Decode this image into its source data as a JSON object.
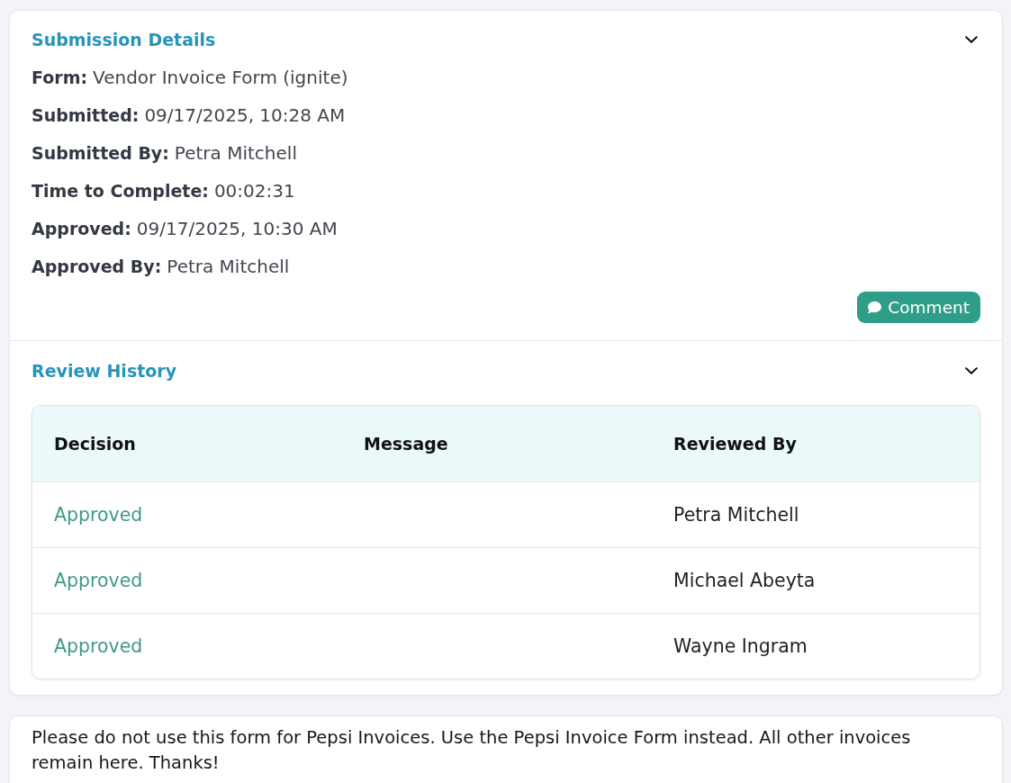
{
  "sections": [
    {
      "kind": "details",
      "title": "Submission Details",
      "expanded": true,
      "fields": [
        {
          "label": "Form:",
          "value": "Vendor Invoice Form (ignite)"
        },
        {
          "label": "Submitted:",
          "value": "09/17/2025, 10:28 AM"
        },
        {
          "label": "Submitted By:",
          "value": "Petra Mitchell"
        },
        {
          "label": "Time to Complete:",
          "value": "00:02:31"
        },
        {
          "label": "Approved:",
          "value": "09/17/2025, 10:30 AM"
        },
        {
          "label": "Approved By:",
          "value": "Petra Mitchell"
        }
      ],
      "button": {
        "label": "Comment"
      }
    },
    {
      "kind": "table",
      "title": "Review History",
      "expanded": true,
      "columns": [
        "Decision",
        "Message",
        "Reviewed By"
      ],
      "rows": [
        {
          "decision": "Approved",
          "reviewed_by": "Petra Mitchell"
        },
        {
          "decision": "Approved",
          "reviewed_by": "Michael Abeyta"
        },
        {
          "decision": "Approved",
          "reviewed_by": "Wayne Ingram"
        }
      ]
    }
  ],
  "notice": "Please do not use this form for Pepsi Invoices. Use the Pepsi Invoice Form instead. All other invoices remain here. Thanks!"
}
